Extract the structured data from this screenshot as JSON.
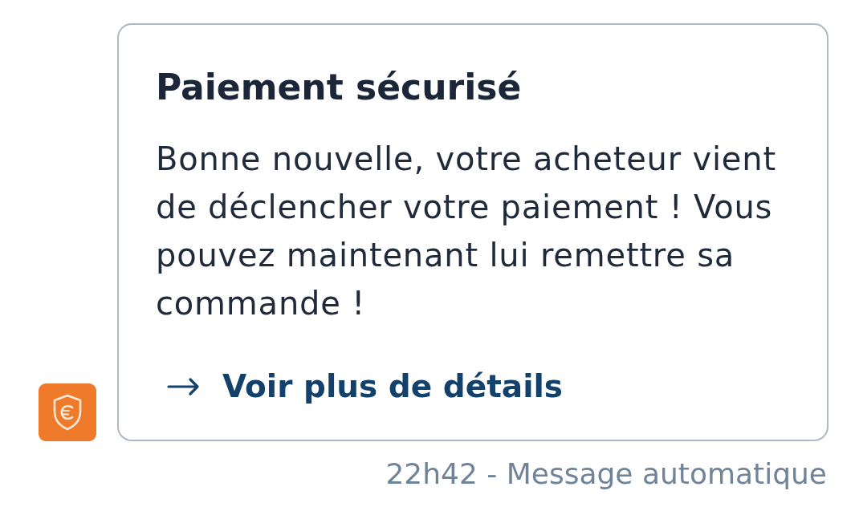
{
  "message": {
    "title": "Paiement sécurisé",
    "body": "Bonne nouvelle, votre acheteur vient de déclencher votre paiement ! Vous pouvez maintenant lui remettre sa commande !",
    "link": "Voir plus de détails"
  },
  "footer": "22h42 - Message automatique"
}
